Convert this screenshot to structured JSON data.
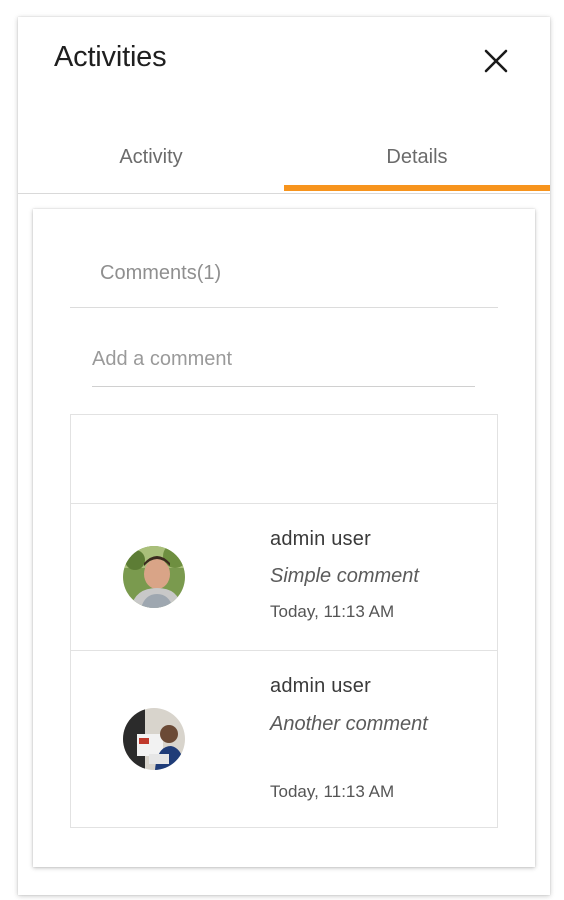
{
  "panel": {
    "title": "Activities",
    "close_icon": "close-icon"
  },
  "tabs": [
    {
      "label": "Activity",
      "active": false
    },
    {
      "label": "Details",
      "active": true
    }
  ],
  "colors": {
    "accent": "#f7941d",
    "tab_text": "#6b6b6b",
    "muted_text": "#8f8f8f"
  },
  "comments": {
    "title": "Comments(1)",
    "input_placeholder": "Add a comment",
    "input_value": "",
    "items": [
      {
        "author": "admin user",
        "text": "Simple comment",
        "timestamp": "Today, 11:13 AM",
        "avatar_icon": "user-avatar"
      },
      {
        "author": "admin user",
        "text": "Another comment",
        "timestamp": "Today, 11:13 AM",
        "avatar_icon": "user-avatar"
      }
    ]
  }
}
